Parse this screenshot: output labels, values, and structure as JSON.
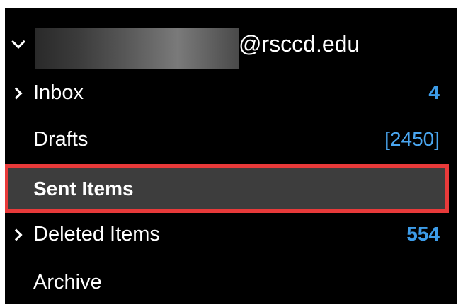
{
  "account": {
    "email_suffix": "@rsccd.edu"
  },
  "folders": [
    {
      "label": "Inbox",
      "count": "4"
    },
    {
      "label": "Drafts",
      "count": "[2450]"
    },
    {
      "label": "Sent Items",
      "count": ""
    },
    {
      "label": "Deleted Items",
      "count": "554"
    },
    {
      "label": "Archive",
      "count": ""
    }
  ],
  "colors": {
    "background": "#000000",
    "selected_row": "#3d3d3d",
    "highlight_border": "#e83a3a",
    "count_accent": "#3d9ce8"
  },
  "icons": {
    "account_toggle": "chevron-down-icon",
    "folder_expand": "chevron-right-icon"
  }
}
